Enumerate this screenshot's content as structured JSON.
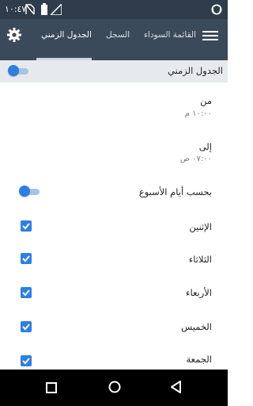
{
  "status_bar": {
    "time": "١٠:٤٧",
    "icons": [
      "vpn-shield-icon",
      "signal-icon",
      "battery-icon",
      "no-sim-icon"
    ]
  },
  "toolbar": {
    "tabs": [
      {
        "label": "القائمة السوداء",
        "active": false
      },
      {
        "label": "السجل",
        "active": false
      },
      {
        "label": "الجدول الزمني",
        "active": true
      }
    ],
    "icons": [
      "menu-icon",
      "settings-gear-icon"
    ]
  },
  "schedule": {
    "section_title": "الجدول الزمني",
    "enabled": true,
    "from_label": "من",
    "from_time": "١٠:٠٠ م",
    "to_label": "إلى",
    "to_time": "٠٧:٠٠ ص",
    "by_weekdays_label": "بحسب أيام الأسبوع",
    "by_weekdays_enabled": true,
    "days": [
      {
        "label": "الإثنين",
        "checked": true
      },
      {
        "label": "الثلاثاء",
        "checked": true
      },
      {
        "label": "الأربعاء",
        "checked": true
      },
      {
        "label": "الخميس",
        "checked": true
      },
      {
        "label": "الجمعة",
        "checked": true
      }
    ]
  },
  "colors": {
    "status_bar": "#2f3c4b",
    "toolbar": "#3b4a5b",
    "accent": "#2f7fe0",
    "section_background": "#e7eaed"
  },
  "nav_bar": {
    "icons": [
      "back-icon",
      "home-icon",
      "recents-icon"
    ]
  }
}
